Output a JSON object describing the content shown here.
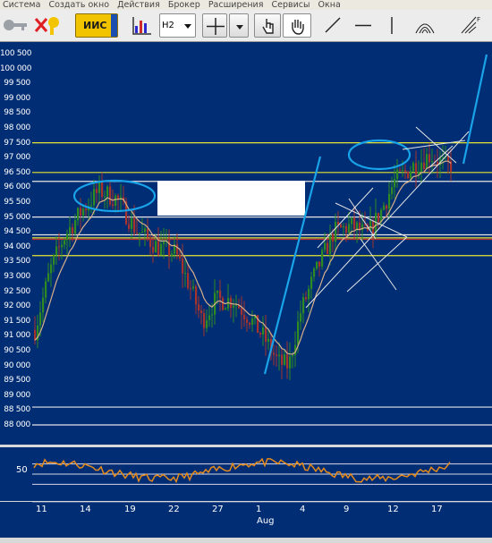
{
  "menu": [
    "Система",
    "Создать окно",
    "Действия",
    "Брокер",
    "Расширения",
    "Сервисы",
    "Окна"
  ],
  "toolbar": {
    "instrument": "ИИС",
    "timeframe": "H2",
    "icons": [
      "key-icon",
      "disconnect-icon",
      "bar-chart-icon",
      "crosshair-icon",
      "dropdown-arrow-icon",
      "hand-pointer-icon",
      "hand-drag-icon",
      "trendline-icon",
      "horizontal-line-icon",
      "vertical-line-icon",
      "arc-icon",
      "fibonacci-icon"
    ]
  },
  "price_axis": {
    "labels": [
      "100 500",
      "100 000",
      "99 500",
      "99 000",
      "98 500",
      "98 000",
      "97 500",
      "97 000",
      "96 500",
      "96 000",
      "95 500",
      "95 000",
      "94 500",
      "94 000",
      "93 500",
      "93 000",
      "92 500",
      "92 000",
      "91 500",
      "91 000",
      "90 500",
      "90 000",
      "89 500",
      "89 000",
      "88 500",
      "88 000"
    ]
  },
  "horizontal_levels": {
    "yellow": [
      97500,
      96500,
      94300,
      93700
    ],
    "white": [
      96200,
      94400,
      95000,
      88600,
      88000
    ],
    "red": [
      94250
    ]
  },
  "oscillator": {
    "label": "50",
    "levels": [
      70,
      50,
      30
    ]
  },
  "date_axis": {
    "labels": [
      "11",
      "14",
      "19",
      "22",
      "27",
      "1",
      "4",
      "9",
      "12",
      "17"
    ],
    "month": "Aug"
  },
  "colors": {
    "background": "#002d74",
    "candle_up": "#2e8b22",
    "candle_down": "#a8322c",
    "moving_average": "#d7b08a",
    "trend_blue": "#19a3e8",
    "level_yellow": "#e6e632",
    "level_white": "#e6e6e6",
    "level_red": "#c03030",
    "oscillator_line": "#e68a1c"
  }
}
